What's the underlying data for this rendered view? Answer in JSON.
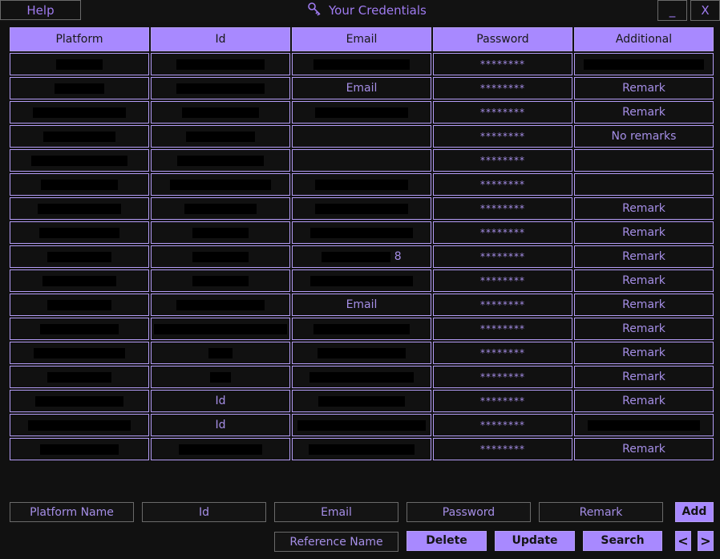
{
  "window": {
    "help_label": "Help",
    "title": "Your Credentials",
    "title_icon": "key-icon",
    "minimize_label": "_",
    "close_label": "X"
  },
  "table": {
    "headers": [
      "Platform",
      "Id",
      "Email",
      "Password",
      "Additional"
    ],
    "rows": [
      {
        "password": "********",
        "additional": ""
      },
      {
        "password": "********",
        "email": "Email",
        "additional": "Remark"
      },
      {
        "password": "********",
        "additional": "Remark"
      },
      {
        "password": "********",
        "additional": "No remarks"
      },
      {
        "password": "********",
        "additional": ""
      },
      {
        "password": "********",
        "additional": ""
      },
      {
        "password": "********",
        "additional": "Remark"
      },
      {
        "password": "********",
        "additional": "Remark"
      },
      {
        "password": "********",
        "email": "8",
        "additional": "Remark"
      },
      {
        "password": "********",
        "additional": "Remark"
      },
      {
        "password": "********",
        "email": "Email",
        "additional": "Remark"
      },
      {
        "password": "********",
        "additional": "Remark"
      },
      {
        "password": "********",
        "additional": "Remark"
      },
      {
        "password": "********",
        "additional": "Remark"
      },
      {
        "password": "********",
        "id": "Id",
        "additional": "Remark"
      },
      {
        "password": "********",
        "id": "Id",
        "additional": ""
      },
      {
        "password": "********",
        "additional": "Remark"
      }
    ]
  },
  "form": {
    "platform_placeholder": "Platform Name",
    "id_placeholder": "Id",
    "email_placeholder": "Email",
    "password_placeholder": "Password",
    "remark_placeholder": "Remark",
    "reference_placeholder": "Reference Name"
  },
  "buttons": {
    "add": "Add",
    "delete": "Delete",
    "update": "Update",
    "search": "Search",
    "prev": "<",
    "next": ">"
  },
  "colors": {
    "accent": "#a889ff",
    "text": "#a58ee6",
    "background": "#111111"
  }
}
